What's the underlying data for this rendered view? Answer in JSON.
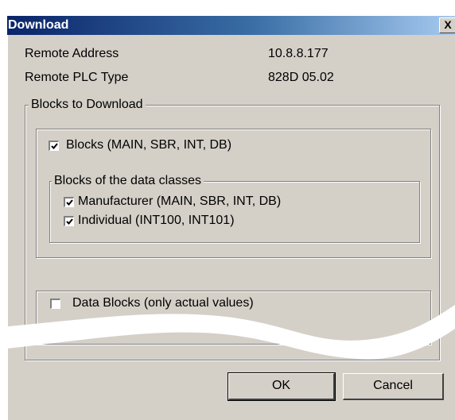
{
  "window": {
    "title": "Download",
    "close_glyph": "X"
  },
  "info": {
    "remote_address_label": "Remote Address",
    "remote_address_value": "10.8.8.177",
    "plc_type_label": "Remote PLC Type",
    "plc_type_value": "828D 05.02"
  },
  "blocks_group": {
    "legend": "Blocks to Download",
    "blocks_checkbox": {
      "label": "Blocks (MAIN, SBR, INT, DB)",
      "checked": true
    },
    "data_classes": {
      "legend": "Blocks of the data classes",
      "items": [
        {
          "label": "Manufacturer (MAIN, SBR, INT, DB)",
          "checked": true
        },
        {
          "label": "Individual (INT100, INT101)",
          "checked": true
        }
      ]
    },
    "data_blocks_checkbox": {
      "label": "Data Blocks (only actual values)",
      "checked": false
    }
  },
  "buttons": {
    "ok": "OK",
    "cancel": "Cancel"
  },
  "icons": [
    "close-icon",
    "checkmark-icon"
  ],
  "colors": {
    "title_start": "#0a246a",
    "title_end": "#a6caf0",
    "face": "#d4d0c8"
  }
}
